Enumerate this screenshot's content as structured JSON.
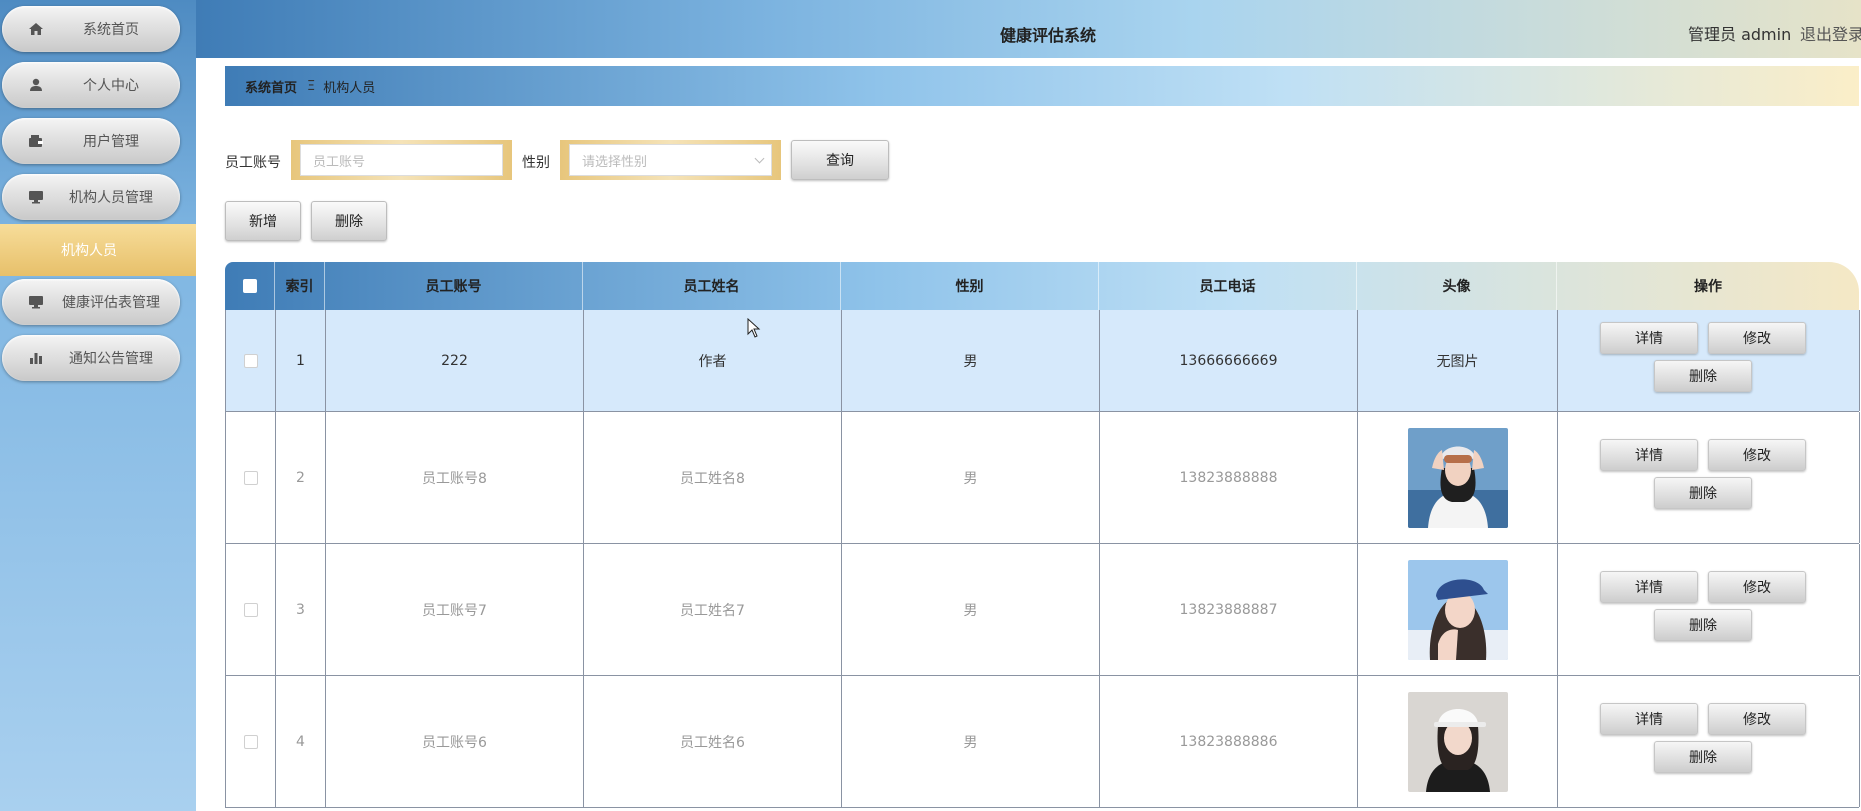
{
  "app": {
    "title": "健康评估系统",
    "user": "管理员 admin",
    "logout": "退出登录"
  },
  "sidebar": {
    "items": [
      {
        "label": "系统首页",
        "icon": "home-icon"
      },
      {
        "label": "个人中心",
        "icon": "user-icon"
      },
      {
        "label": "用户管理",
        "icon": "wallet-icon"
      },
      {
        "label": "机构人员管理",
        "icon": "monitor-icon"
      },
      {
        "label": "机构人员",
        "icon": ""
      },
      {
        "label": "健康评估表管理",
        "icon": "monitor-icon"
      },
      {
        "label": "通知公告管理",
        "icon": "bar-chart-icon"
      }
    ]
  },
  "breadcrumb": {
    "home": "系统首页",
    "separator": "Ξ",
    "current": "机构人员"
  },
  "search": {
    "account_label": "员工账号",
    "account_placeholder": "员工账号",
    "gender_label": "性别",
    "gender_placeholder": "请选择性别",
    "query_button": "查询"
  },
  "actions": {
    "add": "新增",
    "delete": "删除"
  },
  "table": {
    "headers": [
      "",
      "索引",
      "员工账号",
      "员工姓名",
      "性别",
      "员工电话",
      "头像",
      "操作"
    ],
    "rows": [
      {
        "index": "1",
        "account": "222",
        "name": "作者",
        "gender": "男",
        "phone": "13666666669",
        "avatar_text": "无图片"
      },
      {
        "index": "2",
        "account": "员工账号8",
        "name": "员工姓名8",
        "gender": "男",
        "phone": "13823888888",
        "avatar_text": ""
      },
      {
        "index": "3",
        "account": "员工账号7",
        "name": "员工姓名7",
        "gender": "男",
        "phone": "13823888887",
        "avatar_text": ""
      },
      {
        "index": "4",
        "account": "员工账号6",
        "name": "员工姓名6",
        "gender": "男",
        "phone": "13823888886",
        "avatar_text": ""
      }
    ],
    "op_labels": {
      "detail": "详情",
      "edit": "修改",
      "delete": "删除"
    }
  }
}
